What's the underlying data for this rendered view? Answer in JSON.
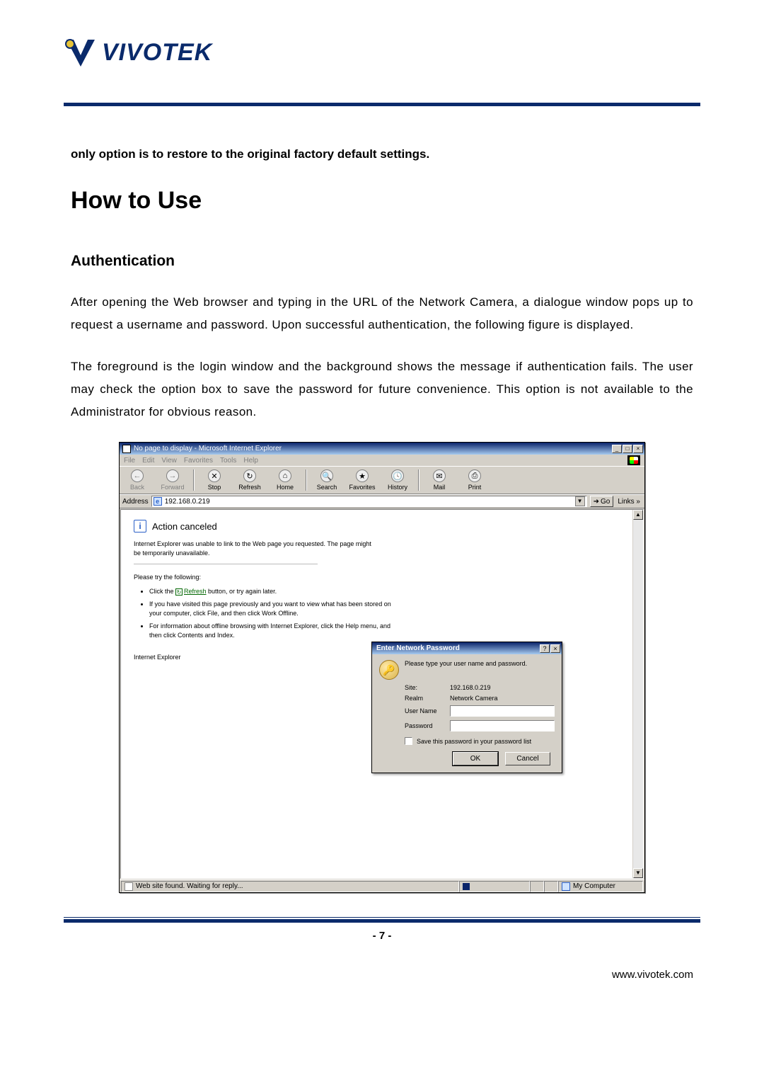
{
  "brand": {
    "name": "VIVOTEK"
  },
  "doc": {
    "lead": "only option is to restore to the original factory default settings.",
    "h1": "How to Use",
    "h2": "Authentication",
    "p1": "After opening the Web browser and typing in the URL of the Network Camera, a dialogue window pops up to request a username and password. Upon successful authentication, the following figure is displayed.",
    "p2": "The foreground is the login window and the background shows the message if authentication fails. The user may check the option box to save the password for future convenience.  This option is not available to the Administrator for obvious reason."
  },
  "ie": {
    "title": "No page to display - Microsoft Internet Explorer",
    "menus": {
      "file": "File",
      "edit": "Edit",
      "view": "View",
      "fav": "Favorites",
      "tools": "Tools",
      "help": "Help"
    },
    "toolbar": {
      "back": "Back",
      "forward": "Forward",
      "stop": "Stop",
      "refresh": "Refresh",
      "home": "Home",
      "search": "Search",
      "favorites": "Favorites",
      "history": "History",
      "mail": "Mail",
      "print": "Print"
    },
    "address_label": "Address",
    "address_value": "192.168.0.219",
    "go": "Go",
    "links": "Links »",
    "cancel": {
      "heading": "Action canceled",
      "msg": "Internet Explorer was unable to link to the Web page you requested. The page might be temporarily unavailable.",
      "try": "Please try the following:",
      "li1a": "Click the ",
      "li1_refresh": "Refresh",
      "li1b": " button, or try again later.",
      "li2": "If you have visited this page previously and you want to view what has been stored on your computer, click File, and then click Work Offline.",
      "li3": "For information about offline browsing with Internet Explorer, click the Help menu, and then click Contents and Index.",
      "ie_label": "Internet Explorer"
    },
    "dialog": {
      "title": "Enter Network Password",
      "prompt": "Please type your user name and password.",
      "site_lbl": "Site:",
      "site_val": "192.168.0.219",
      "realm_lbl": "Realm",
      "realm_val": "Network Camera",
      "user_lbl": "User Name",
      "pass_lbl": "Password",
      "save": "Save this password in your password list",
      "ok": "OK",
      "cancel": "Cancel"
    },
    "status": {
      "msg": "Web site found. Waiting for reply...",
      "zone": "My Computer"
    }
  },
  "footer": {
    "page": "- 7 -",
    "url": "www.vivotek.com"
  }
}
